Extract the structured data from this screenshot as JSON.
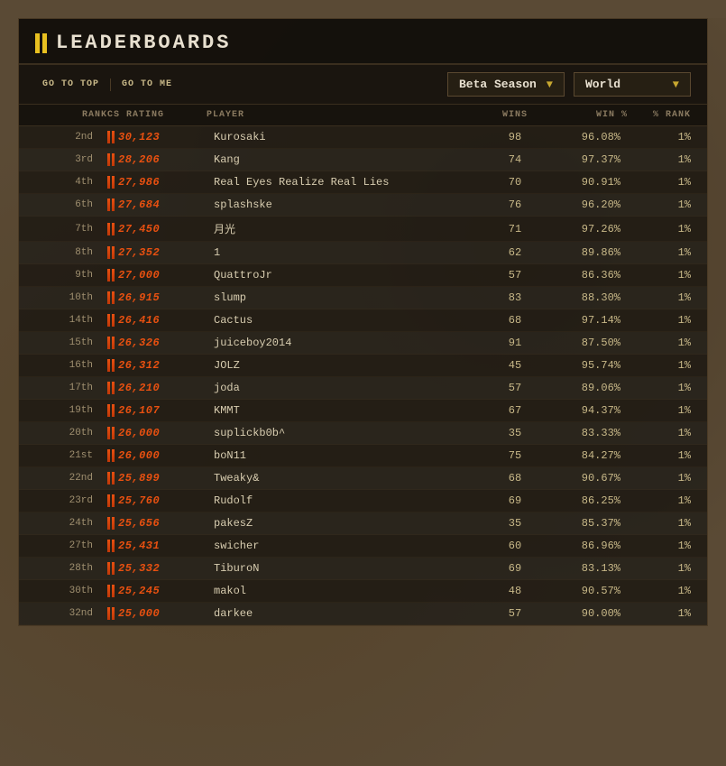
{
  "header": {
    "title": "LEADERBOARDS",
    "bars_icon": "double-bars"
  },
  "toolbar": {
    "go_to_top_label": "GO TO TOP",
    "go_to_me_label": "GO TO ME",
    "season_dropdown": {
      "label": "Beta Season",
      "arrow": "▼"
    },
    "region_dropdown": {
      "label": "World",
      "arrow": "▼"
    }
  },
  "table": {
    "headers": {
      "rank": "Rank",
      "cs_rating": "CS Rating",
      "player": "Player",
      "wins": "Wins",
      "win_pct": "Win %",
      "rank_pct": "% Rank"
    },
    "rows": [
      {
        "rank": "2nd",
        "rating": "30,123",
        "player": "Kurosaki",
        "wins": 98,
        "win_pct": "96.08%",
        "rank_pct": "1%"
      },
      {
        "rank": "3rd",
        "rating": "28,206",
        "player": "Kang",
        "wins": 74,
        "win_pct": "97.37%",
        "rank_pct": "1%"
      },
      {
        "rank": "4th",
        "rating": "27,986",
        "player": "Real Eyes Realize Real Lies",
        "wins": 70,
        "win_pct": "90.91%",
        "rank_pct": "1%"
      },
      {
        "rank": "6th",
        "rating": "27,684",
        "player": "splashske",
        "wins": 76,
        "win_pct": "96.20%",
        "rank_pct": "1%"
      },
      {
        "rank": "7th",
        "rating": "27,450",
        "player": "月光",
        "wins": 71,
        "win_pct": "97.26%",
        "rank_pct": "1%"
      },
      {
        "rank": "8th",
        "rating": "27,352",
        "player": "1",
        "wins": 62,
        "win_pct": "89.86%",
        "rank_pct": "1%"
      },
      {
        "rank": "9th",
        "rating": "27,000",
        "player": "QuattroJr",
        "wins": 57,
        "win_pct": "86.36%",
        "rank_pct": "1%"
      },
      {
        "rank": "10th",
        "rating": "26,915",
        "player": "slump",
        "wins": 83,
        "win_pct": "88.30%",
        "rank_pct": "1%"
      },
      {
        "rank": "14th",
        "rating": "26,416",
        "player": "Cactus",
        "wins": 68,
        "win_pct": "97.14%",
        "rank_pct": "1%"
      },
      {
        "rank": "15th",
        "rating": "26,326",
        "player": "juiceboy2014",
        "wins": 91,
        "win_pct": "87.50%",
        "rank_pct": "1%"
      },
      {
        "rank": "16th",
        "rating": "26,312",
        "player": "JOLZ",
        "wins": 45,
        "win_pct": "95.74%",
        "rank_pct": "1%"
      },
      {
        "rank": "17th",
        "rating": "26,210",
        "player": "joda",
        "wins": 57,
        "win_pct": "89.06%",
        "rank_pct": "1%"
      },
      {
        "rank": "19th",
        "rating": "26,107",
        "player": "KMMT",
        "wins": 67,
        "win_pct": "94.37%",
        "rank_pct": "1%"
      },
      {
        "rank": "20th",
        "rating": "26,000",
        "player": "suplickb0b^",
        "wins": 35,
        "win_pct": "83.33%",
        "rank_pct": "1%"
      },
      {
        "rank": "21st",
        "rating": "26,000",
        "player": "boN11",
        "wins": 75,
        "win_pct": "84.27%",
        "rank_pct": "1%"
      },
      {
        "rank": "22nd",
        "rating": "25,899",
        "player": "Tweaky&",
        "wins": 68,
        "win_pct": "90.67%",
        "rank_pct": "1%"
      },
      {
        "rank": "23rd",
        "rating": "25,760",
        "player": "Rudolf",
        "wins": 69,
        "win_pct": "86.25%",
        "rank_pct": "1%"
      },
      {
        "rank": "24th",
        "rating": "25,656",
        "player": "pakesZ",
        "wins": 35,
        "win_pct": "85.37%",
        "rank_pct": "1%"
      },
      {
        "rank": "27th",
        "rating": "25,431",
        "player": "swicher",
        "wins": 60,
        "win_pct": "86.96%",
        "rank_pct": "1%"
      },
      {
        "rank": "28th",
        "rating": "25,332",
        "player": "TiburoN",
        "wins": 69,
        "win_pct": "83.13%",
        "rank_pct": "1%"
      },
      {
        "rank": "30th",
        "rating": "25,245",
        "player": "makol",
        "wins": 48,
        "win_pct": "90.57%",
        "rank_pct": "1%"
      },
      {
        "rank": "32nd",
        "rating": "25,000",
        "player": "darkee",
        "wins": 57,
        "win_pct": "90.00%",
        "rank_pct": "1%"
      }
    ]
  }
}
